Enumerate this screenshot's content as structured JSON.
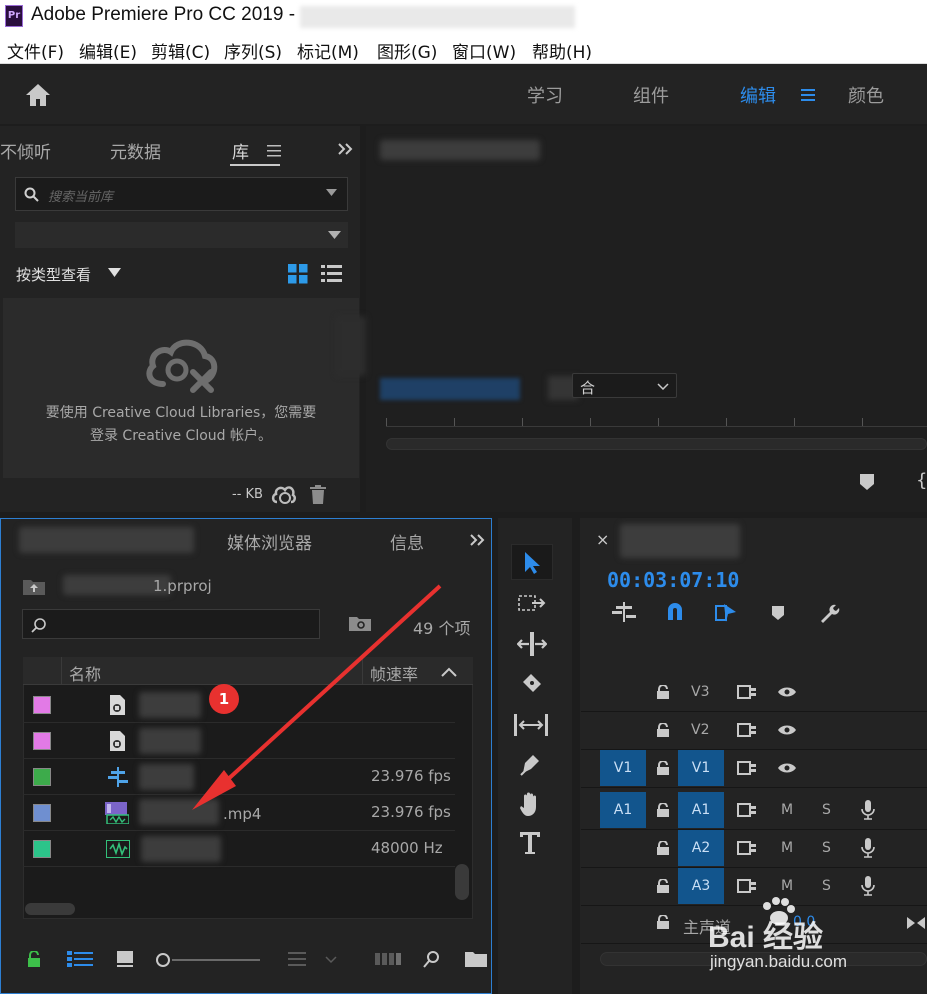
{
  "window": {
    "app_title": "Adobe Premiere Pro CC 2019 -",
    "title_suffix": "ojbe  ...  ...  ]"
  },
  "menu": [
    "文件(F)",
    "编辑(E)",
    "剪辑(C)",
    "序列(S)",
    "标记(M)",
    "图形(G)",
    "窗口(W)",
    "帮助(H)"
  ],
  "workspaces": {
    "items": [
      "学习",
      "组件",
      "编辑",
      "颜色"
    ],
    "active": "编辑"
  },
  "libraries_panel": {
    "tabs": [
      "不倾听",
      "元数据",
      "库"
    ],
    "active_tab": "库",
    "search_placeholder": "搜索当前库",
    "view_label": "按类型查看",
    "message_line1": "要使用 Creative Cloud Libraries，您需要",
    "message_line2": "登录 Creative Cloud 帐户。",
    "storage": "-- KB"
  },
  "program_monitor": {
    "fit_label": "合"
  },
  "project_panel": {
    "tabs": [
      "媒体浏览器",
      "信息"
    ],
    "project_file": "1.prproj",
    "item_count": "49 个项",
    "col_name": "名称",
    "col_fps": "帧速率",
    "rows": [
      {
        "color": "#e27ae6",
        "name": "",
        "fps": ""
      },
      {
        "color": "#e27ae6",
        "name": "",
        "fps": ""
      },
      {
        "color": "#3dab4b",
        "name": "",
        "fps": "23.976 fps"
      },
      {
        "color": "#6f8fd0",
        "name": ".mp4",
        "fps": "23.976 fps"
      },
      {
        "color": "#2cc48a",
        "name": "",
        "fps": "48000 Hz"
      }
    ],
    "badge": "1"
  },
  "timeline": {
    "timecode": "00:03:07:10",
    "close_glyph": "×",
    "tracks": [
      {
        "label": "V3",
        "type": "video"
      },
      {
        "label": "V2",
        "type": "video"
      },
      {
        "label": "V1",
        "type": "video",
        "source": "V1"
      },
      {
        "label": "A1",
        "type": "audio",
        "source": "A1"
      },
      {
        "label": "A2",
        "type": "audio"
      },
      {
        "label": "A3",
        "type": "audio"
      }
    ],
    "mute_label": "M",
    "solo_label": "S",
    "master_label": "主声道",
    "master_value": "0.0"
  },
  "tools": [
    "selection",
    "track-select",
    "ripple-edit",
    "razor",
    "slip",
    "pen",
    "hand",
    "type"
  ],
  "watermark": {
    "brand": "Bai 经验",
    "url": "jingyan.baidu.com"
  },
  "colors": {
    "accent": "#2d8ceb",
    "track_target": "#12558d",
    "panel_bg": "#232323"
  }
}
